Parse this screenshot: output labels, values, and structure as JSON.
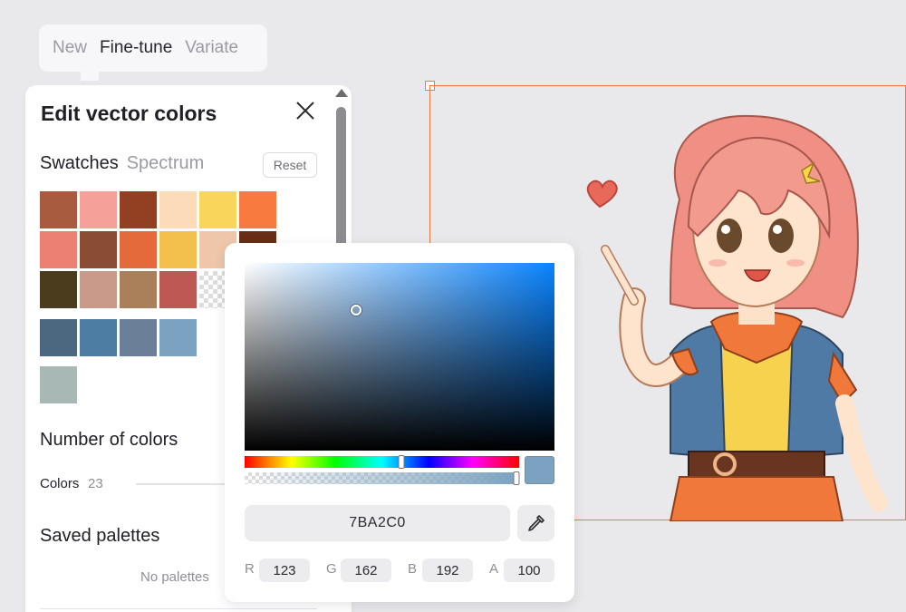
{
  "mode_tabs": [
    {
      "label": "New",
      "active": false
    },
    {
      "label": "Fine-tune",
      "active": true
    },
    {
      "label": "Variate",
      "active": false
    }
  ],
  "panel": {
    "title": "Edit vector colors",
    "close_icon": "close-icon",
    "tabs": [
      {
        "label": "Swatches",
        "active": true
      },
      {
        "label": "Spectrum",
        "active": false
      }
    ],
    "reset_label": "Reset",
    "swatches": [
      {
        "color": "#a85b3e"
      },
      {
        "color": "#f5a19a"
      },
      {
        "color": "#923f22"
      },
      {
        "color": "#fcdcb8"
      },
      {
        "color": "#f9d65b"
      },
      {
        "color": "#f87a3e"
      },
      {
        "color": "#ec8072"
      },
      {
        "color": "#8a4d34"
      },
      {
        "color": "#e56a3b"
      },
      {
        "color": "#f3c04d"
      },
      {
        "color": "#eec7ab"
      },
      {
        "color": "#6a2e16"
      },
      {
        "color": "#4a3c1c"
      },
      {
        "color": "#c9998a"
      },
      {
        "color": "#a9805a"
      },
      {
        "color": "#bd5854"
      },
      {
        "color": "transparent"
      },
      {
        "color": "#4b6880"
      },
      {
        "color": "#4e7da4"
      },
      {
        "color": "#6b7f98"
      },
      {
        "color": "#7ba2c0",
        "selected": true
      },
      {
        "color": "#a8b8b4"
      }
    ],
    "number_of_colors_title": "Number of colors",
    "colors_label": "Colors",
    "colors_count": "23",
    "saved_palettes_title": "Saved palettes",
    "no_palettes_text": "No palettes"
  },
  "picker": {
    "hex": "7BA2C0",
    "preview_color": "#7ba2c0",
    "eyedropper_icon": "eyedropper-icon",
    "channels": [
      {
        "label": "R",
        "value": "123"
      },
      {
        "label": "G",
        "value": "162"
      },
      {
        "label": "B",
        "value": "192"
      },
      {
        "label": "A",
        "value": "100"
      }
    ],
    "hue_position": 0.57,
    "alpha_position": 1.0,
    "sv_saturation": 0.36,
    "sv_value": 0.75
  },
  "canvas": {
    "accent_color": "#f07a3a"
  }
}
